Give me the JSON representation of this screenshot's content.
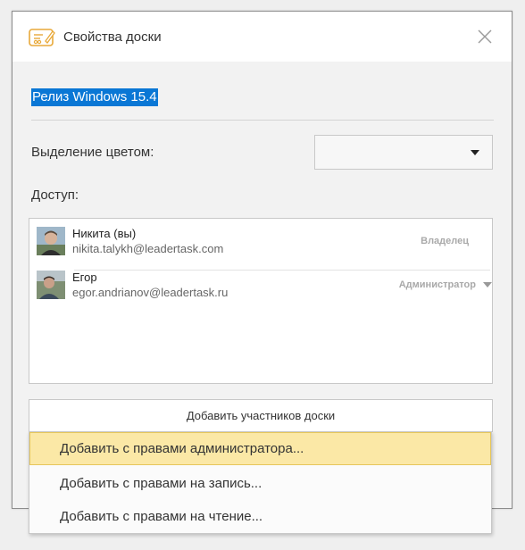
{
  "dialog": {
    "title": "Свойства доски",
    "close_icon": "close-icon",
    "board_icon": "board-icon"
  },
  "board": {
    "name": "Релиз Windows 15.4"
  },
  "color": {
    "label": "Выделение цветом:",
    "value": ""
  },
  "access": {
    "label": "Доступ:",
    "members": [
      {
        "name": "Никита (вы)",
        "email": "nikita.talykh@leadertask.com",
        "role": "Владелец"
      },
      {
        "name": "Егор",
        "email": "egor.andrianov@leadertask.ru",
        "role": "Администратор"
      }
    ]
  },
  "add_button": {
    "label": "Добавить участников доски"
  },
  "dropdown": {
    "items": [
      {
        "label": "Добавить с правами администратора..."
      },
      {
        "label": "Добавить с правами на запись..."
      },
      {
        "label": "Добавить с правами на чтение..."
      }
    ]
  },
  "colors": {
    "selection": "#0a77d5",
    "highlight": "#fbe8a6",
    "icon_accent": "#e8a93a"
  }
}
